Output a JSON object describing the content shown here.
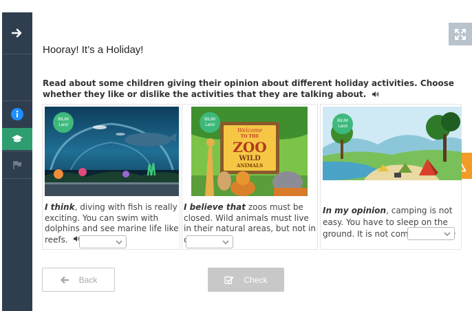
{
  "activity": {
    "title": "Hooray! It’s a Holiday!",
    "instructions": "Read about some children giving their opinion about different holiday activities. Choose whether they like or dislike the activities that they are talking about."
  },
  "sidebar": {
    "items": [
      {
        "icon": "arrow-right-icon"
      },
      {
        "icon": "info-icon",
        "color": "#1e90ff"
      },
      {
        "icon": "graduation-cap-icon",
        "active": true,
        "color": "#2e9e70"
      },
      {
        "icon": "flag-icon"
      }
    ]
  },
  "cards": [
    {
      "image": "aquarium",
      "badge": "BILIM Land",
      "opinion": "I think",
      "text": ", diving with fish is really exciting. You can swim with dolphins and see marine life like reefs.",
      "selected": ""
    },
    {
      "image": "zoo",
      "badge": "BILIM Land",
      "opinion": "I believe that",
      "text": " zoos must be closed. Wild animals must live in their natural areas, but not in cages.",
      "selected": "",
      "sign": {
        "welcome": "Welcome",
        "to_the": "TO THE",
        "zoo": "ZOO",
        "wild": "WILD",
        "animals": "ANIMALS"
      }
    },
    {
      "image": "camping",
      "badge": "BILIM Land",
      "opinion": "In my opinion",
      "text": ", camping is not easy. You have to sleep on the ground. It is not comfortable.",
      "selected": ""
    }
  ],
  "buttons": {
    "back": "Back",
    "check": "Check"
  },
  "colors": {
    "sidebar": "#2f3e4e",
    "accent": "#2e9e70",
    "alert": "#f39c25",
    "check_disabled": "#c8c8c8"
  }
}
